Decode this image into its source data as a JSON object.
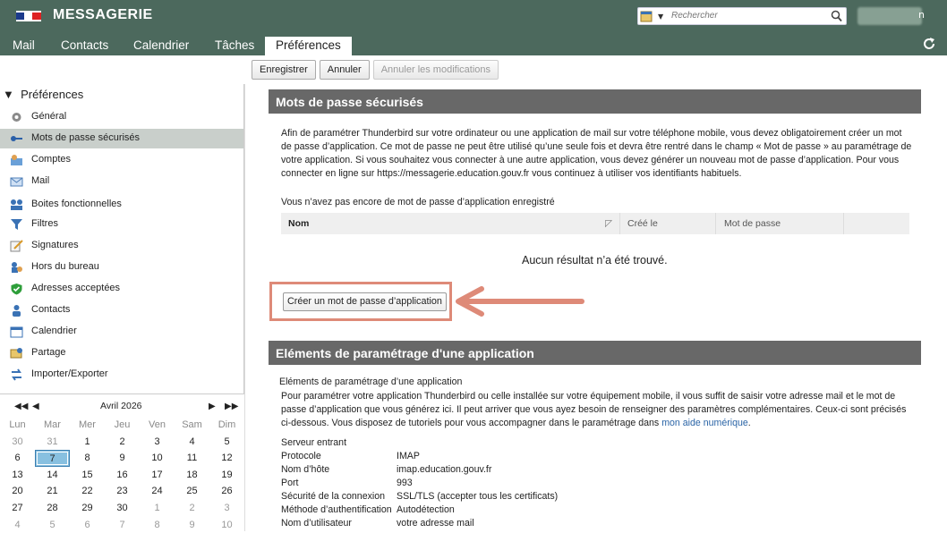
{
  "app": {
    "title": "MESSAGERIE",
    "search_placeholder": "Rechercher",
    "user_suffix": "n"
  },
  "tabs": [
    "Mail",
    "Contacts",
    "Calendrier",
    "Tâches",
    "Préférences"
  ],
  "toolbar": {
    "save": "Enregistrer",
    "cancel": "Annuler",
    "undo": "Annuler les modifications"
  },
  "sidebar": {
    "header": "Préférences",
    "items": [
      {
        "label": "Général",
        "icon": "gear-icon"
      },
      {
        "label": "Mots de passe sécurisés",
        "icon": "key-icon"
      },
      {
        "label": "Comptes",
        "icon": "accounts-icon"
      },
      {
        "label": "Mail",
        "icon": "mail-icon"
      },
      {
        "label": "Boites fonctionnelles",
        "icon": "shared-boxes-icon"
      },
      {
        "label": "Filtres",
        "icon": "filter-icon"
      },
      {
        "label": "Signatures",
        "icon": "signature-icon"
      },
      {
        "label": "Hors du bureau",
        "icon": "out-of-office-icon"
      },
      {
        "label": "Adresses acceptées",
        "icon": "shield-check-icon"
      },
      {
        "label": "Contacts",
        "icon": "contact-icon"
      },
      {
        "label": "Calendrier",
        "icon": "calendar-icon"
      },
      {
        "label": "Partage",
        "icon": "share-icon"
      },
      {
        "label": "Importer/Exporter",
        "icon": "import-export-icon"
      }
    ]
  },
  "calendar": {
    "title": "Avril 2026",
    "weekdays": [
      "Lun",
      "Mar",
      "Mer",
      "Jeu",
      "Ven",
      "Sam",
      "Dim"
    ],
    "weeks": [
      [
        "30",
        "31",
        "1",
        "2",
        "3",
        "4",
        "5"
      ],
      [
        "6",
        "7",
        "8",
        "9",
        "10",
        "11",
        "12"
      ],
      [
        "13",
        "14",
        "15",
        "16",
        "17",
        "18",
        "19"
      ],
      [
        "20",
        "21",
        "22",
        "23",
        "24",
        "25",
        "26"
      ],
      [
        "27",
        "28",
        "29",
        "30",
        "1",
        "2",
        "3"
      ],
      [
        "4",
        "5",
        "6",
        "7",
        "8",
        "9",
        "10"
      ]
    ],
    "today": "7"
  },
  "passwords": {
    "title": "Mots de passe sécurisés",
    "intro": "Afin de paramétrer Thunderbird sur votre ordinateur ou une application de mail sur votre téléphone mobile, vous devez obligatoirement créer un mot de passe d’application. Ce mot de passe ne peut être utilisé qu’une seule fois et devra être rentré dans le champ « Mot de passe » au paramétrage de votre application. Si vous souhaitez vous connecter à une autre application, vous devez générer un nouveau mot de passe d’application. Pour vous connecter en ligne sur https://messagerie.education.gouv.fr vous continuez à utiliser vos identifiants habituels.",
    "none_registered": "Vous n’avez pas encore de mot de passe d’application enregistré",
    "columns": [
      "Nom",
      "Créé le",
      "Mot de passe"
    ],
    "no_result": "Aucun résultat n’a été trouvé.",
    "create_button": "Créer un mot de passe d’application"
  },
  "app_settings": {
    "title": "Eléments de paramétrage d'une application",
    "subtitle": "Eléments de paramétrage d’une application",
    "desc": "Pour paramétrer votre application Thunderbird ou celle installée sur votre équipement mobile, il vous suffit de saisir votre adresse mail et le mot de passe d’application que vous générez ici. Il peut arriver que vous ayez besoin de renseigner des paramètres complémentaires. Ceux-ci sont précisés ci-dessous. Vous disposez de tutoriels pour vous accompagner dans le paramétrage dans",
    "link": "mon aide numérique",
    "incoming_label": "Serveur entrant",
    "rows": [
      {
        "k": "Protocole",
        "v": "IMAP"
      },
      {
        "k": "Nom d’hôte",
        "v": "imap.education.gouv.fr"
      },
      {
        "k": "Port",
        "v": "993"
      },
      {
        "k": "Sécurité de la connexion",
        "v": "SSL/TLS (accepter tous les certificats)"
      },
      {
        "k": "Méthode d’authentification",
        "v": "Autodétection"
      },
      {
        "k": "Nom d’utilisateur",
        "v": "votre adresse mail"
      }
    ]
  },
  "colors": {
    "header": "#4c695d",
    "section": "#686868",
    "highlight": "#de8a78"
  }
}
